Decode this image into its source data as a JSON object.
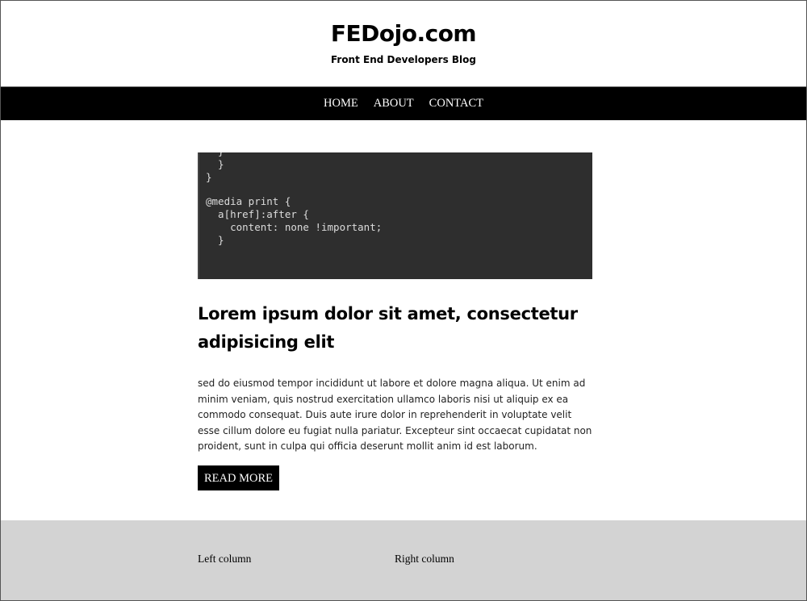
{
  "header": {
    "site_title": "FEDojo.com",
    "tagline": "Front End Developers Blog"
  },
  "nav": {
    "items": [
      {
        "label": "HOME"
      },
      {
        "label": "ABOUT"
      },
      {
        "label": "CONTACT"
      }
    ]
  },
  "post": {
    "image": {
      "code_lines": [
        "  }",
        "}",
        "",
        "@media print {",
        "  a[href]:after {",
        "    content: none !important;",
        "  }"
      ]
    },
    "title": "Lorem ipsum dolor sit amet, consectetur adipisicing elit",
    "excerpt": "sed do eiusmod tempor incididunt ut labore et dolore magna aliqua. Ut enim ad minim veniam, quis nostrud exercitation ullamco laboris nisi ut aliquip ex ea commodo consequat. Duis aute irure dolor in reprehenderit in voluptate velit esse cillum dolore eu fugiat nulla pariatur. Excepteur sint occaecat cupidatat non proident, sunt in culpa qui officia deserunt mollit anim id est laborum.",
    "read_more_label": "READ MORE"
  },
  "footer": {
    "left_label": "Left column",
    "right_label": "Right column"
  },
  "colors": {
    "nav_bg": "#000000",
    "footer_bg": "#d3d3d3",
    "code_bg": "#2e2e2e"
  }
}
